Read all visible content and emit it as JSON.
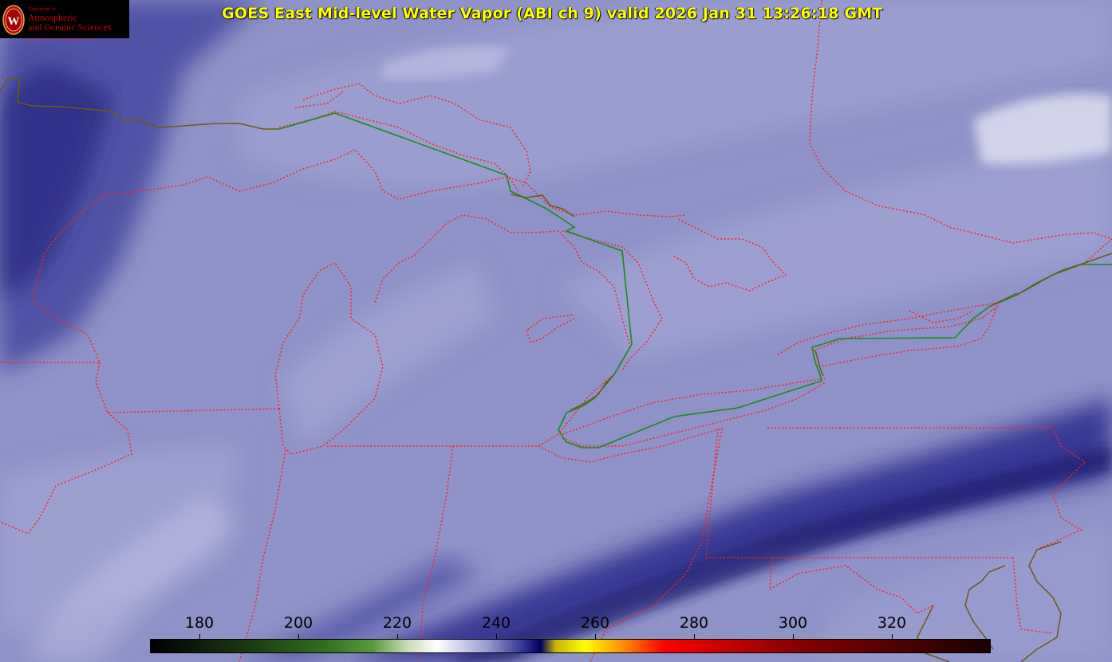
{
  "title": "GOES East Mid-level Water Vapor (ABI ch 9)  valid 2026 Jan 31 13:26:18 GMT",
  "logo": {
    "dept": "Department of",
    "line1": "Atmospheric",
    "line2": "and Oceanic Sciences",
    "icon": "uw-crest-icon"
  },
  "colorbar": {
    "min": 170,
    "max": 340,
    "ticks": [
      "180",
      "200",
      "220",
      "240",
      "260",
      "280",
      "300",
      "320"
    ],
    "stops": [
      {
        "v": 170,
        "c": "#000000"
      },
      {
        "v": 190,
        "c": "#1b3a12"
      },
      {
        "v": 205,
        "c": "#2f6e1c"
      },
      {
        "v": 215,
        "c": "#5a9b3c"
      },
      {
        "v": 222,
        "c": "#c8dcb8"
      },
      {
        "v": 228,
        "c": "#ffffff"
      },
      {
        "v": 238,
        "c": "#9a9dd0"
      },
      {
        "v": 246,
        "c": "#2a2c8e"
      },
      {
        "v": 249,
        "c": "#000060"
      },
      {
        "v": 252,
        "c": "#c8b400"
      },
      {
        "v": 258,
        "c": "#ffff00"
      },
      {
        "v": 266,
        "c": "#ff8800"
      },
      {
        "v": 274,
        "c": "#ff0000"
      },
      {
        "v": 300,
        "c": "#8a0000"
      },
      {
        "v": 340,
        "c": "#1a0000"
      }
    ]
  },
  "colors": {
    "boundary": "#ff2020",
    "intl_border": "#1a8a1a",
    "coast": "#6b5a14",
    "title": "#ffff00"
  }
}
